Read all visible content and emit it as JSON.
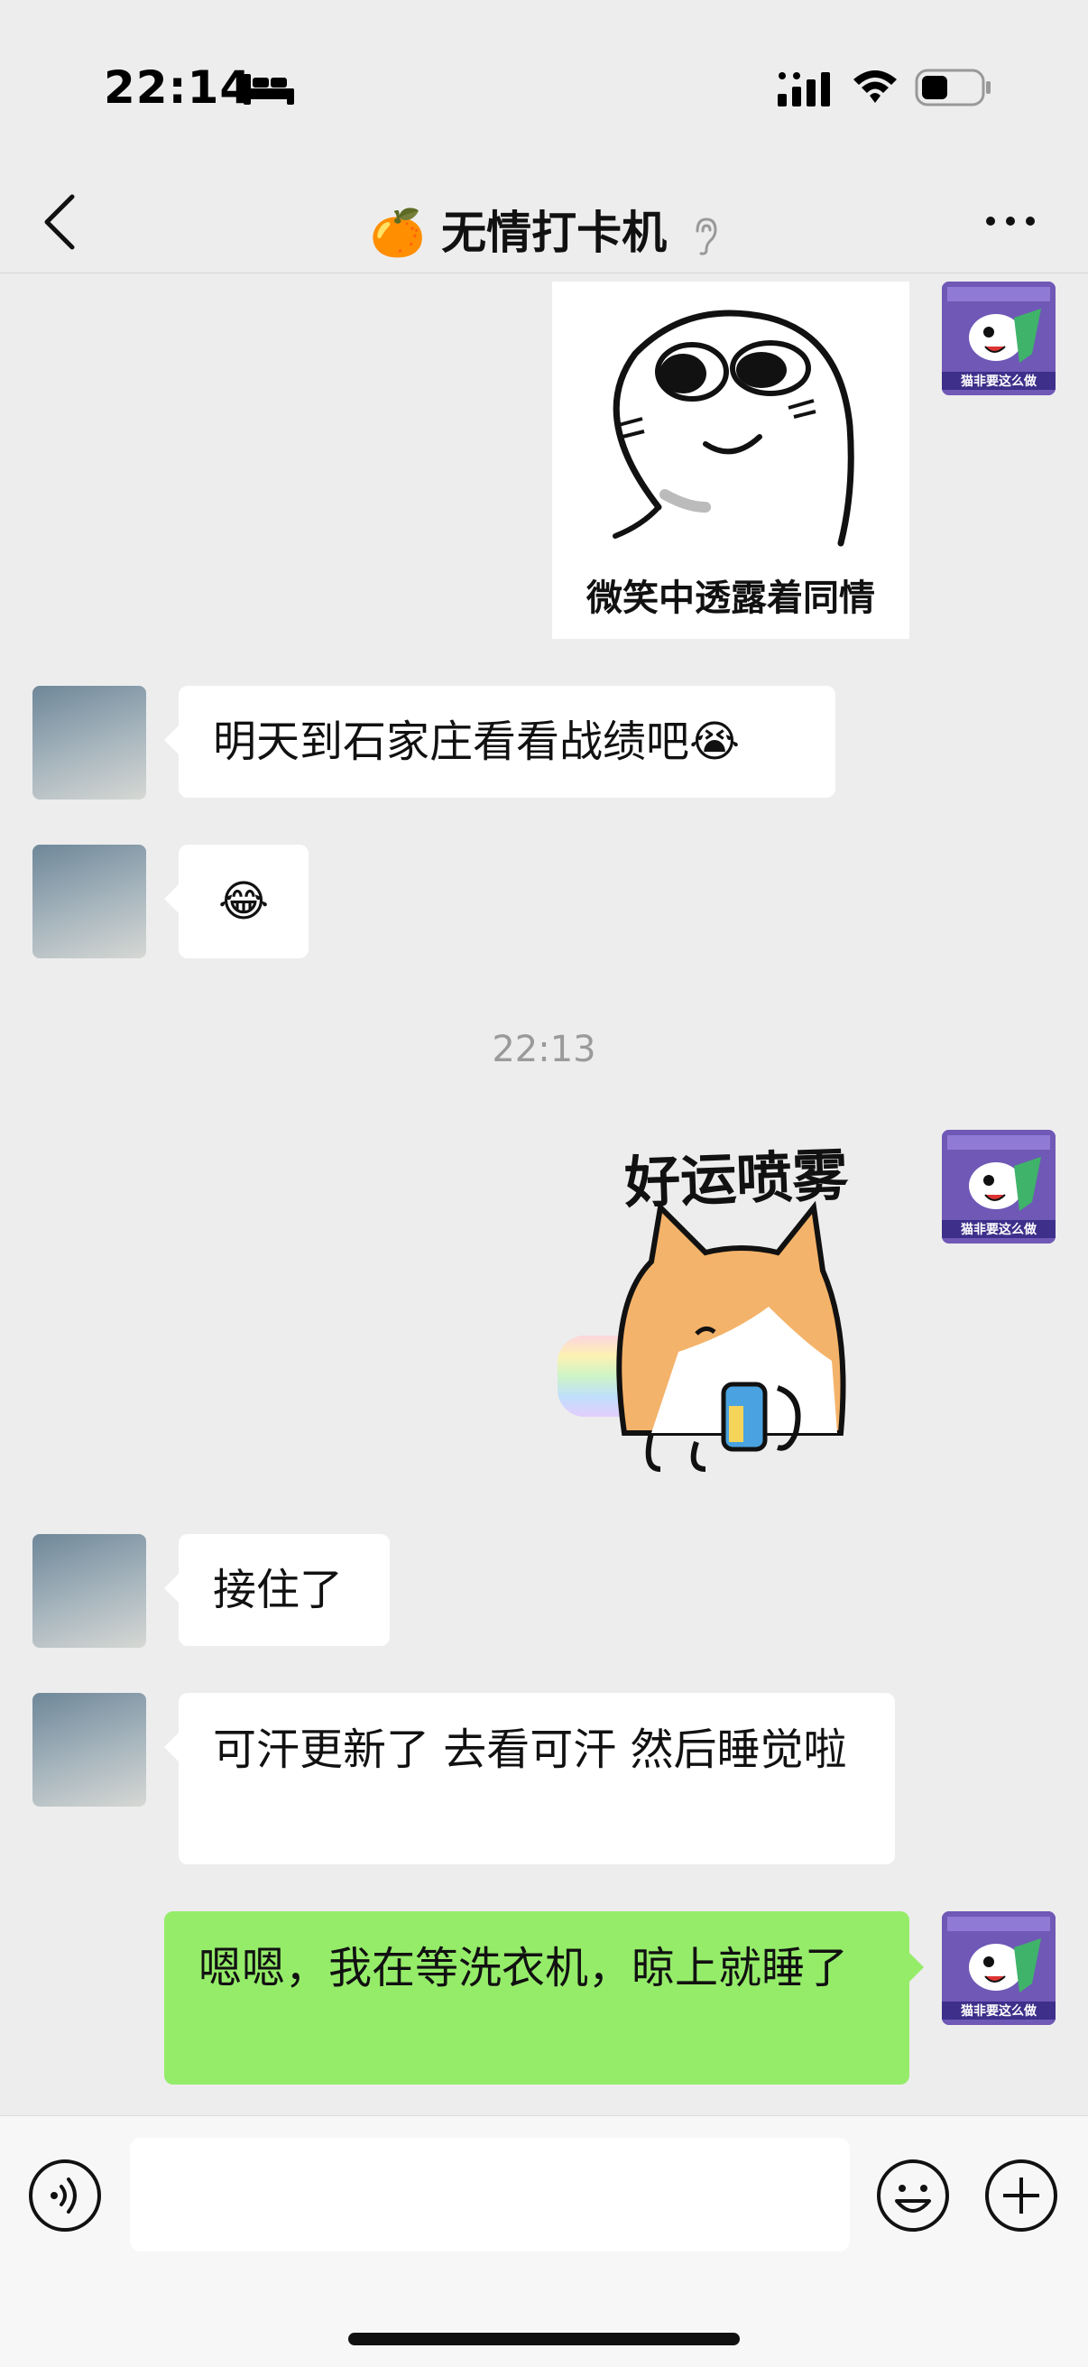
{
  "status_bar": {
    "time": "22:14",
    "icons": [
      "sleep-bed-icon",
      "cellular-signal-icon",
      "wifi-icon",
      "battery-icon"
    ]
  },
  "nav": {
    "title_emoji": "🍊",
    "title": "无情打卡机",
    "icons": [
      "back-icon",
      "earpiece-icon",
      "more-icon"
    ]
  },
  "messages": [
    {
      "from": "self",
      "type": "sticker",
      "caption": "微笑中透露着同情"
    },
    {
      "from": "contact",
      "type": "text",
      "text": "明天到石家庄看看战绩吧😭"
    },
    {
      "from": "contact",
      "type": "text",
      "text": "😂"
    },
    {
      "from": "system",
      "type": "timestamp",
      "text": "22:13"
    },
    {
      "from": "self",
      "type": "sticker",
      "caption": "好运喷雾"
    },
    {
      "from": "contact",
      "type": "text",
      "text": "接住了"
    },
    {
      "from": "contact",
      "type": "text",
      "text": "可汗更新了 去看可汗 然后睡觉啦"
    },
    {
      "from": "self",
      "type": "text",
      "text": "嗯嗯，我在等洗衣机，晾上就睡了"
    }
  ],
  "self_avatar": {
    "text": "猫非要这么做"
  },
  "input_bar": {
    "placeholder": "",
    "icons": [
      "voice-icon",
      "emoji-icon",
      "plus-icon"
    ]
  },
  "colors": {
    "background": "#ededed",
    "outgoing_bubble": "#95ec69",
    "incoming_bubble": "#ffffff",
    "avatar_purple": "#6f58b6"
  }
}
